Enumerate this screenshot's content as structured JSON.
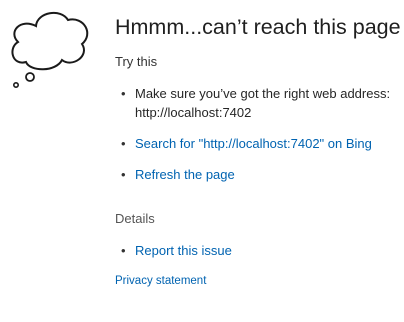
{
  "error": {
    "title": "Hmmm...can’t reach this page",
    "icon": "thought-cloud-icon"
  },
  "suggestions": {
    "heading": "Try this",
    "bullet": "•",
    "items": [
      {
        "text": "Make sure you’ve got the right web address: http://localhost:7402",
        "is_link": false
      },
      {
        "text": "Search for \"http://localhost:7402\" on Bing",
        "is_link": true
      },
      {
        "text": "Refresh the page",
        "is_link": true
      }
    ]
  },
  "details": {
    "heading": "Details",
    "items": [
      {
        "text": "Report this issue",
        "is_link": true
      }
    ]
  },
  "footer": {
    "privacy_label": "Privacy statement"
  },
  "colors": {
    "link": "#0063b1",
    "text": "#262626",
    "muted": "#555555"
  }
}
